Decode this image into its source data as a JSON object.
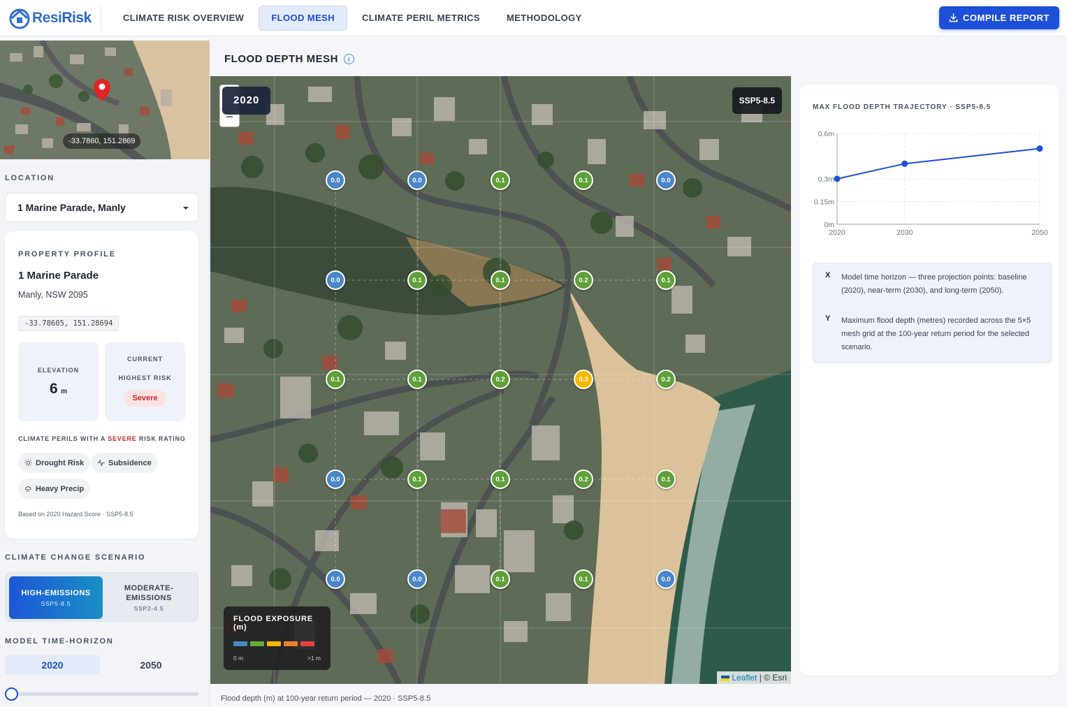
{
  "header": {
    "brand_resi": "Resi",
    "brand_risk": "Risk",
    "nav": [
      {
        "label": "CLIMATE RISK OVERVIEW",
        "active": false
      },
      {
        "label": "FLOOD MESH",
        "active": true
      },
      {
        "label": "CLIMATE PERIL METRICS",
        "active": false
      },
      {
        "label": "METHODOLOGY",
        "active": false
      }
    ],
    "compile_label": "COMPILE REPORT"
  },
  "sidebar": {
    "minimap_coords": "-33.7860, 151.2869",
    "location_label": "LOCATION",
    "location_value": "1 Marine Parade, Manly",
    "profile": {
      "section_label": "PROPERTY PROFILE",
      "street": "1 Marine Parade",
      "suburb": "Manly, NSW 2095",
      "coords": "-33.78605, 151.28694",
      "elevation_label": "ELEVATION",
      "elevation_value": "6",
      "elevation_unit": "m",
      "risk_label_1": "CURRENT",
      "risk_label_2": "HIGHEST RISK",
      "risk_value": "Severe",
      "perils_prefix": "CLIMATE PERILS WITH A",
      "perils_highlight": "SEVERE",
      "perils_suffix": "RISK RATING",
      "perils": [
        "Drought Risk",
        "Subsidence",
        "Heavy Precip"
      ],
      "footnote": "Based on 2020 Hazard Score · SSP5-8.5"
    },
    "scenario_label": "CLIMATE CHANGE SCENARIO",
    "scenarios": [
      {
        "title_1": "HIGH-EMISSIONS",
        "title_2": "",
        "code": "SSP5-8.5",
        "active": true
      },
      {
        "title_1": "MODERATE-",
        "title_2": "EMISSIONS",
        "code": "SSP2-4.5",
        "active": false
      }
    ],
    "horizon_label": "MODEL TIME-HORIZON",
    "horizon_years": [
      "2020",
      "2050"
    ],
    "horizon_selected": "2020",
    "horizon_slider_fraction": 0
  },
  "main": {
    "title": "FLOOD DEPTH MESH",
    "info_glyph": "i",
    "year_badge": "2020",
    "scenario_badge": "SSP5-8.5",
    "zoom_minus": "−",
    "mesh": [
      [
        "0.0",
        "0.0",
        "0.1",
        "0.1",
        "0.0"
      ],
      [
        "0.0",
        "0.1",
        "0.1",
        "0.2",
        "0.1"
      ],
      [
        "0.1",
        "0.1",
        "0.2",
        "0.3",
        "0.2"
      ],
      [
        "0.0",
        "0.1",
        "0.1",
        "0.2",
        "0.1"
      ],
      [
        "0.0",
        "0.0",
        "0.1",
        "0.1",
        "0.0"
      ]
    ],
    "legend": {
      "title": "FLOOD EXPOSURE (m)",
      "colors": [
        "#4a86c8",
        "#6aaa3a",
        "#f5b800",
        "#f08030",
        "#e84040"
      ],
      "min_label": "0 m",
      "max_label": ">1 m"
    },
    "attribution_leaflet": "Leaflet",
    "attribution_rest": "| © Esri",
    "caption": "Flood depth (m) at 100-year return period — 2020 · SSP5-8.5"
  },
  "colors": {
    "node_0.0": "#4a86c8",
    "node_0.1": "#5fa038",
    "node_0.2": "#5fa038",
    "node_0.3": "#f5b800",
    "accent": "#1d4fd8",
    "severe": "#c62828"
  },
  "chart_data": {
    "type": "line",
    "title": "MAX FLOOD DEPTH TRAJECTORY · SSP5-8.5",
    "x": [
      2020,
      2030,
      2050
    ],
    "x_tick_labels": [
      "2020",
      "2030",
      "2050"
    ],
    "series": [
      {
        "values": [
          0.3,
          0.4,
          0.5
        ]
      }
    ],
    "y_tick_values": [
      0,
      0.15,
      0.3,
      0.6
    ],
    "y_tick_labels": [
      "0m",
      "0.15m",
      "0.3m",
      "0.6m"
    ],
    "ylim": [
      0,
      0.6
    ],
    "grid": true,
    "color": "#1d4fd8",
    "notes": [
      {
        "key": "X",
        "text": "Model time horizon — three projection points: baseline (2020), near-term (2030), and long-term (2050)."
      },
      {
        "key": "Y",
        "text": "Maximum flood depth (metres) recorded across the 5×5 mesh grid at the 100-year return period for the selected scenario."
      }
    ]
  }
}
